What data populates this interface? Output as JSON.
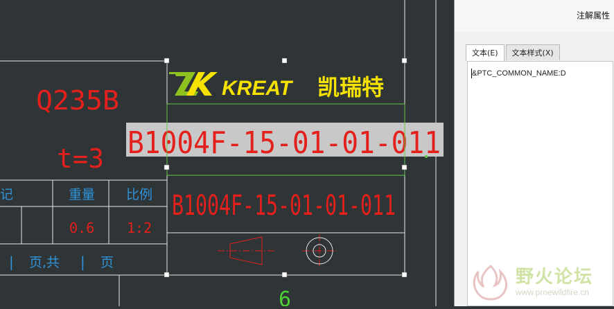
{
  "drawing": {
    "material": "Q235B",
    "thickness": "t=3",
    "title_block": {
      "label_record": "记",
      "label_weight": "重量",
      "label_scale": "比例",
      "weight_value": "0.6",
      "scale_value": "1:2",
      "page_sep_1": "|",
      "page_label": "页,共",
      "page_sep_2": "|",
      "page_suffix": "页"
    },
    "logo": {
      "mark": "K",
      "brand": "KREAT",
      "brand_cn": "凯瑞特"
    },
    "selected_text": "B1004F-15-01-01-011",
    "part_number": "B1004F-15-01-01-011",
    "bottom_number": "6"
  },
  "colors": {
    "canvas": "#2f3437",
    "lines": "#e8e8e8",
    "red_text": "#e3201b",
    "blue_text": "#2f93d8",
    "selection_frame": "#63c84a",
    "selection_bg": "#c8c8c8",
    "logo_green": "#8dc21f",
    "logo_yellow": "#f5e200"
  },
  "panel": {
    "title": "注解属性",
    "tabs": [
      {
        "label": "文本(E)",
        "active": true
      },
      {
        "label": "文本样式(X)",
        "active": false
      }
    ],
    "editor_text": "&PTC_COMMON_NAME:D"
  },
  "watermark": {
    "site_cn": "野火论坛",
    "url": "www.proewildfire.cn"
  }
}
